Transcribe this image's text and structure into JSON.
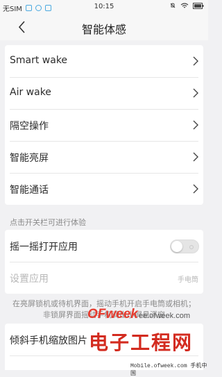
{
  "status_bar": {
    "carrier": "无SIM",
    "time": "10:15"
  },
  "header": {
    "title": "智能体感"
  },
  "settings": [
    {
      "label": "Smart wake"
    },
    {
      "label": "Air wake"
    },
    {
      "label": "隔空操作"
    },
    {
      "label": "智能亮屏"
    },
    {
      "label": "智能通话"
    }
  ],
  "section": {
    "hint": "点击开关栏可进行体验",
    "shake_label": "摇一摇打开应用",
    "shake_enabled": false,
    "set_app_label": "设置应用",
    "set_app_value": "手电筒",
    "description": "在亮屏锁机或待机界面，摇动手机开启手电筒或相机；非锁屏界面摇动手机调出小屏悬浮窗"
  },
  "tilt": {
    "label": "倾斜手机缩放图片"
  },
  "watermark": {
    "brand": "OFweek",
    "url": "ee.ofweek.com",
    "text": "电子工程网",
    "footer": "Mobile.ofweek.com 手机中国"
  },
  "colors": {
    "accent": "#4aa9e0",
    "watermark_red": "#d32b1f"
  }
}
